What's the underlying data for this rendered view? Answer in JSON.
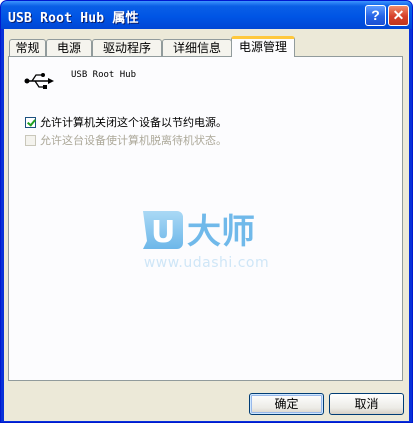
{
  "window": {
    "title": "USB Root Hub 属性",
    "help_label": "?",
    "close_label": "✕"
  },
  "tabs": [
    {
      "label": "常规",
      "active": false
    },
    {
      "label": "电源",
      "active": false
    },
    {
      "label": "驱动程序",
      "active": false
    },
    {
      "label": "详细信息",
      "active": false
    },
    {
      "label": "电源管理",
      "active": true
    }
  ],
  "panel": {
    "device_name": "USB Root Hub",
    "device_icon": "usb-icon",
    "options": [
      {
        "label": "允许计算机关闭这个设备以节约电源。",
        "checked": true,
        "enabled": true
      },
      {
        "label": "允许这台设备使计算机脱离待机状态。",
        "checked": false,
        "enabled": false
      }
    ],
    "watermark": {
      "logo_letter": "U",
      "logo_text": "大师",
      "url": "www.udashi.com"
    }
  },
  "buttons": {
    "ok": "确定",
    "cancel": "取消"
  },
  "colors": {
    "titlebar": "#0055e5",
    "face": "#ece9d8",
    "tab_highlight": "#ffc83c",
    "watermark": "#cfe6f7"
  }
}
